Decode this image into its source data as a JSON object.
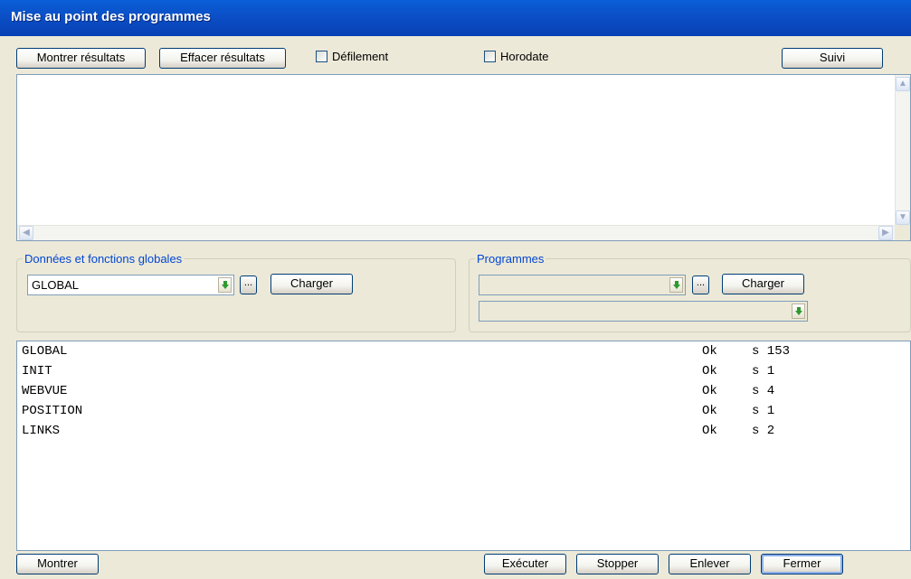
{
  "window": {
    "title": "Mise au point des programmes"
  },
  "toolbar": {
    "show_results": "Montrer résultats",
    "clear_results": "Effacer résultats",
    "scroll_label": "Défilement",
    "timestamp_label": "Horodate",
    "follow": "Suivi"
  },
  "globals_group": {
    "legend": "Données et fonctions globales",
    "selected": "GLOBAL",
    "browse": "...",
    "load": "Charger"
  },
  "programs_group": {
    "legend": "Programmes",
    "selected": "",
    "selected2": "",
    "browse": "...",
    "load": "Charger"
  },
  "results": [
    {
      "name": "GLOBAL",
      "status": "Ok",
      "size": "s 153"
    },
    {
      "name": "INIT",
      "status": "Ok",
      "size": "s 1"
    },
    {
      "name": "WEBVUE",
      "status": "Ok",
      "size": "s 4"
    },
    {
      "name": "POSITION",
      "status": "Ok",
      "size": "s 1"
    },
    {
      "name": "LINKS",
      "status": "Ok",
      "size": "s 2"
    }
  ],
  "footer": {
    "show": "Montrer",
    "execute": "Exécuter",
    "stop": "Stopper",
    "remove": "Enlever",
    "close": "Fermer"
  }
}
